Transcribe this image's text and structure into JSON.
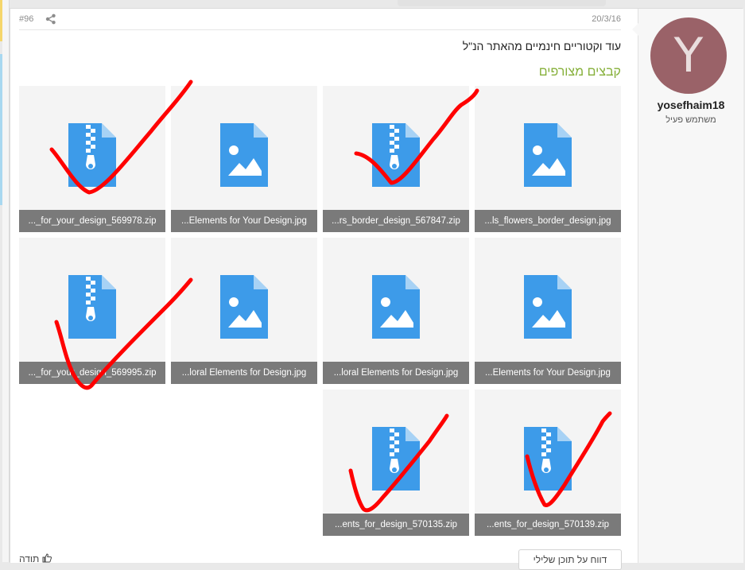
{
  "post": {
    "number": "#96",
    "date": "20/3/16",
    "text": "עוד וקטוריים חינמיים מהאתר הנ\"ל",
    "attachments_title": "קבצים מצורפים"
  },
  "user": {
    "avatar_letter": "Y",
    "avatar_color": "#9a6268",
    "name": "yosefhaim18",
    "title": "משתמש פעיל"
  },
  "attachments": [
    {
      "type": "zip",
      "name": "..._for_your_design_569978.zip"
    },
    {
      "type": "image",
      "name": "...Elements for Your Design.jpg"
    },
    {
      "type": "zip",
      "name": "...rs_border_design_567847.zip"
    },
    {
      "type": "image",
      "name": "...ls_flowers_border_design.jpg"
    },
    {
      "type": "zip",
      "name": "..._for_your_design_569995.zip"
    },
    {
      "type": "image",
      "name": "...loral Elements for Design.jpg"
    },
    {
      "type": "image",
      "name": "...loral Elements for Design.jpg"
    },
    {
      "type": "image",
      "name": "...Elements for Your Design.jpg"
    },
    {
      "type": "zip",
      "name": "...ents_for_design_570135.zip"
    },
    {
      "type": "zip",
      "name": "...ents_for_design_570139.zip"
    }
  ],
  "footer": {
    "report": "דווח על תוכן שלילי",
    "like": "תודה"
  },
  "colors": {
    "accent_green": "#86b03a",
    "file_icon_blue": "#3d9be9",
    "check_red": "#ff0000"
  },
  "icons": [
    "share-icon",
    "zip-file-icon",
    "image-file-icon",
    "thumbs-up-icon"
  ]
}
